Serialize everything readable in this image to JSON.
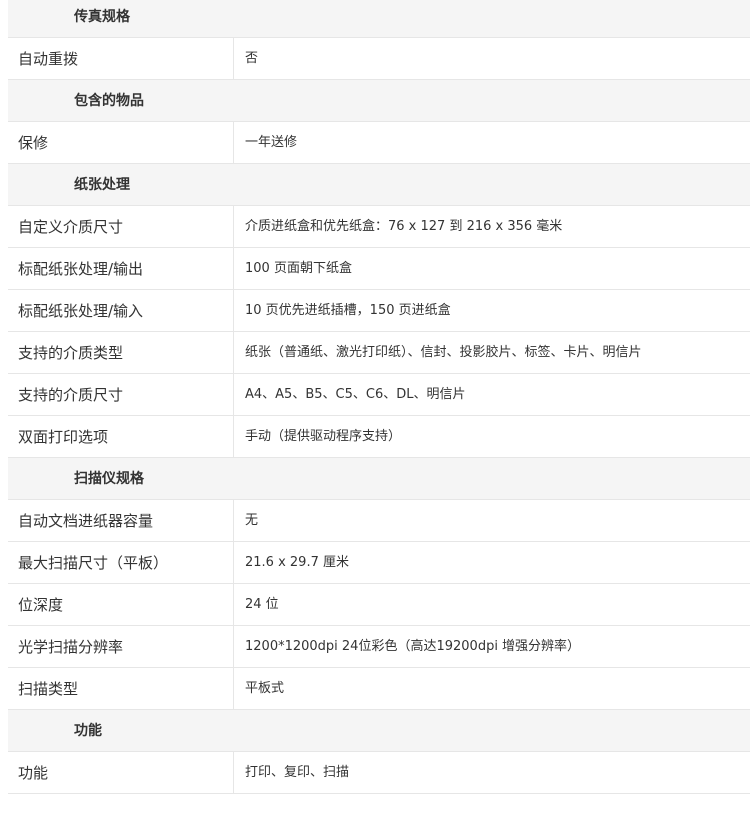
{
  "sections": [
    {
      "title": "传真规格",
      "rows": [
        {
          "label": "自动重拨",
          "value": "否"
        }
      ]
    },
    {
      "title": "包含的物品",
      "rows": [
        {
          "label": "保修",
          "value": "一年送修"
        }
      ]
    },
    {
      "title": "纸张处理",
      "rows": [
        {
          "label": "自定义介质尺寸",
          "value": "介质进纸盒和优先纸盒：76 x 127 到 216 x 356 毫米"
        },
        {
          "label": "标配纸张处理/输出",
          "value": "100 页面朝下纸盒"
        },
        {
          "label": "标配纸张处理/输入",
          "value": "10 页优先进纸插槽，150 页进纸盒"
        },
        {
          "label": "支持的介质类型",
          "value": "纸张（普通纸、激光打印纸）、信封、投影胶片、标签、卡片、明信片"
        },
        {
          "label": "支持的介质尺寸",
          "value": "A4、A5、B5、C5、C6、DL、明信片"
        },
        {
          "label": "双面打印选项",
          "value": "手动（提供驱动程序支持）"
        }
      ]
    },
    {
      "title": "扫描仪规格",
      "rows": [
        {
          "label": "自动文档进纸器容量",
          "value": "无"
        },
        {
          "label": "最大扫描尺寸（平板）",
          "value": "21.6 x 29.7 厘米"
        },
        {
          "label": "位深度",
          "value": "24 位"
        },
        {
          "label": "光学扫描分辨率",
          "value": "1200*1200dpi 24位彩色（高达19200dpi 增强分辨率）"
        },
        {
          "label": "扫描类型",
          "value": "平板式"
        }
      ]
    },
    {
      "title": "功能",
      "rows": [
        {
          "label": "功能",
          "value": "打印、复印、扫描"
        }
      ]
    }
  ]
}
